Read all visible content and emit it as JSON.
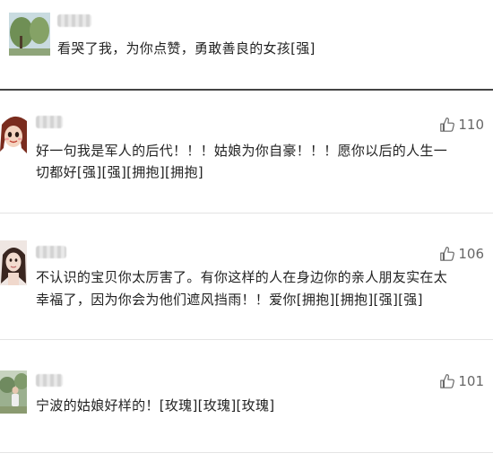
{
  "reply": {
    "text": "看哭了我，为你点赞，勇敢善良的女孩[强]"
  },
  "comments": [
    {
      "text_line1": "好一句我是军人的后代！！！姑娘为你自豪！！！愿你以后的人生一",
      "text_line2": "切都好[强][强][拥抱][拥抱]",
      "likes": "110",
      "avatar_icon": "cartoon-girl-avatar"
    },
    {
      "text_line1": "不认识的宝贝你太厉害了。有你这样的人在身边你的亲人朋友实在太",
      "text_line2": "幸福了，因为你会为他们遮风挡雨！！爱你[拥抱][拥抱][强][强]",
      "likes": "106",
      "avatar_icon": "woman-photo-avatar"
    },
    {
      "text_line1": "宁波的姑娘好样的！[玫瑰][玫瑰][玫瑰]",
      "likes": "101",
      "avatar_icon": "outdoor-person-avatar"
    }
  ],
  "icons": {
    "like": "thumbs-up-icon"
  },
  "colors": {
    "text": "#222222",
    "like_count": "#666666",
    "divider": "#e4e4e4",
    "section_divider": "#444444"
  }
}
